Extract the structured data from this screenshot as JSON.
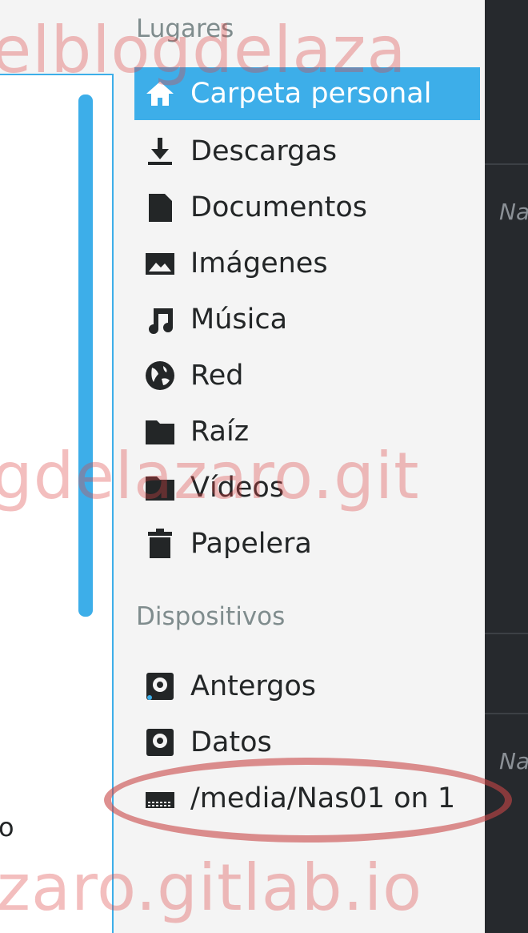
{
  "left_pane": {
    "visible_text": "o"
  },
  "places": {
    "title": "Lugares",
    "items": [
      {
        "label": "Carpeta personal",
        "icon": "home-icon",
        "selected": true
      },
      {
        "label": "Descargas",
        "icon": "download-icon"
      },
      {
        "label": "Documentos",
        "icon": "document-icon"
      },
      {
        "label": "Imágenes",
        "icon": "image-icon"
      },
      {
        "label": "Música",
        "icon": "music-icon"
      },
      {
        "label": "Red",
        "icon": "globe-icon"
      },
      {
        "label": "Raíz",
        "icon": "folder-icon"
      },
      {
        "label": "Vídeos",
        "icon": "video-icon"
      },
      {
        "label": "Papelera",
        "icon": "trash-icon"
      }
    ]
  },
  "devices": {
    "title": "Dispositivos",
    "items": [
      {
        "label": "Antergos",
        "icon": "drive-icon"
      },
      {
        "label": "Datos",
        "icon": "drive-icon"
      },
      {
        "label": "/media/Nas01 on 1",
        "icon": "network-drive-icon"
      }
    ]
  },
  "dark_pane": {
    "text_1": "Na",
    "text_2": "Na"
  },
  "watermark": {
    "line1": "elblogdelaza",
    "line2": "gdelazaro.git",
    "line3": "zaro.gitlab.io"
  },
  "colors": {
    "selection": "#3daee9",
    "dark_bg": "#26292d",
    "watermark": "#dc4646"
  }
}
